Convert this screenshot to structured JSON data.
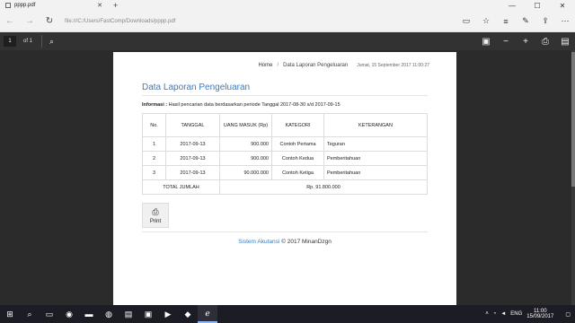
{
  "browser": {
    "tab_title": "pppp.pdf",
    "url": "file:///C:/Users/FastComp/Downloads/pppp.pdf"
  },
  "pdf_toolbar": {
    "page_number": "1",
    "page_count": "of 1"
  },
  "page": {
    "breadcrumb_home": "Home",
    "breadcrumb_current": "Data Laporan Pengeluaran",
    "datetime": "Jumat, 15 September 2017 11:00:27",
    "title": "Data Laporan Pengeluaran",
    "info_label": "Informasi :",
    "info_text": "Hasil pencarian data berdasarkan periode Tanggal 2017-08-30 s/d 2017-09-15",
    "table": {
      "headers": [
        "No.",
        "TANGGAL",
        "UANG MASUK (Rp)",
        "KATEGORI",
        "KETERANGAN"
      ],
      "rows": [
        {
          "no": "1",
          "tanggal": "2017-09-13",
          "uang": "900.000",
          "kategori": "Contoh Pertama",
          "keterangan": "Teguran"
        },
        {
          "no": "2",
          "tanggal": "2017-09-13",
          "uang": "900.000",
          "kategori": "Contoh Kedua",
          "keterangan": "Pemberitahuan"
        },
        {
          "no": "3",
          "tanggal": "2017-09-13",
          "uang": "90.000.000",
          "kategori": "Contoh Ketiga",
          "keterangan": "Pemberitahuan"
        }
      ],
      "total_label": "TOTAL JUMLAH",
      "total_value": "Rp. 91.800.000"
    },
    "print_label": "Print",
    "footer_brand": "Sistem Akutansi",
    "footer_rest": "© 2017 MinanDzgn"
  },
  "taskbar": {
    "language": "ENG",
    "time": "11:00",
    "date": "15/09/2017"
  },
  "colors": {
    "accent": "#3a7bbf"
  }
}
